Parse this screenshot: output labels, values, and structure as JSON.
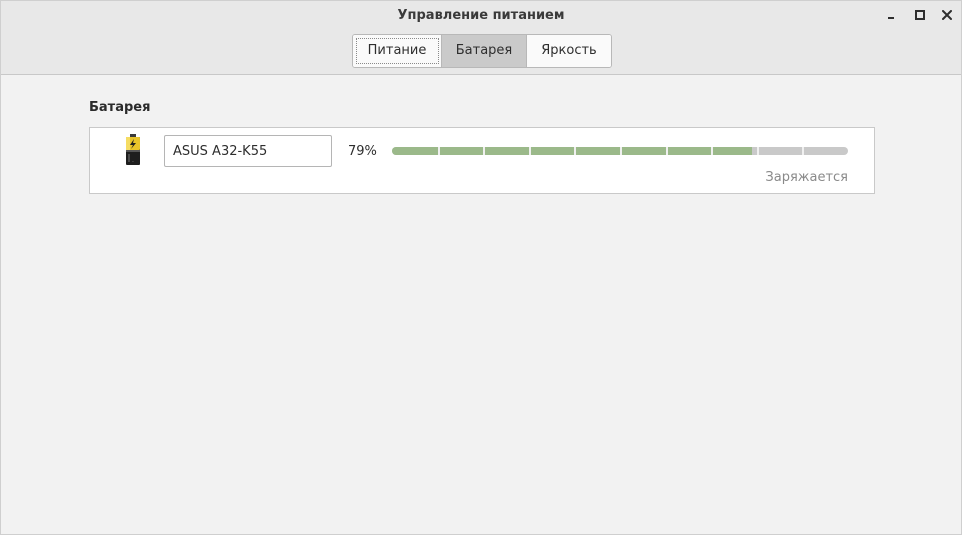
{
  "window": {
    "title": "Управление питанием"
  },
  "tabs": [
    {
      "label": "Питание",
      "selected": false
    },
    {
      "label": "Батарея",
      "selected": true
    },
    {
      "label": "Яркость",
      "selected": false
    }
  ],
  "battery_section": {
    "title": "Батарея",
    "device": {
      "icon": "battery-charging-icon",
      "name": "ASUS A32-K55",
      "percent_text": "79%",
      "level_fraction": 0.79,
      "status": "Заряжается"
    }
  },
  "colors": {
    "level_fill": "#9bb98a",
    "level_trough": "#c9c9c9",
    "selected_tab": "#cacaca"
  }
}
